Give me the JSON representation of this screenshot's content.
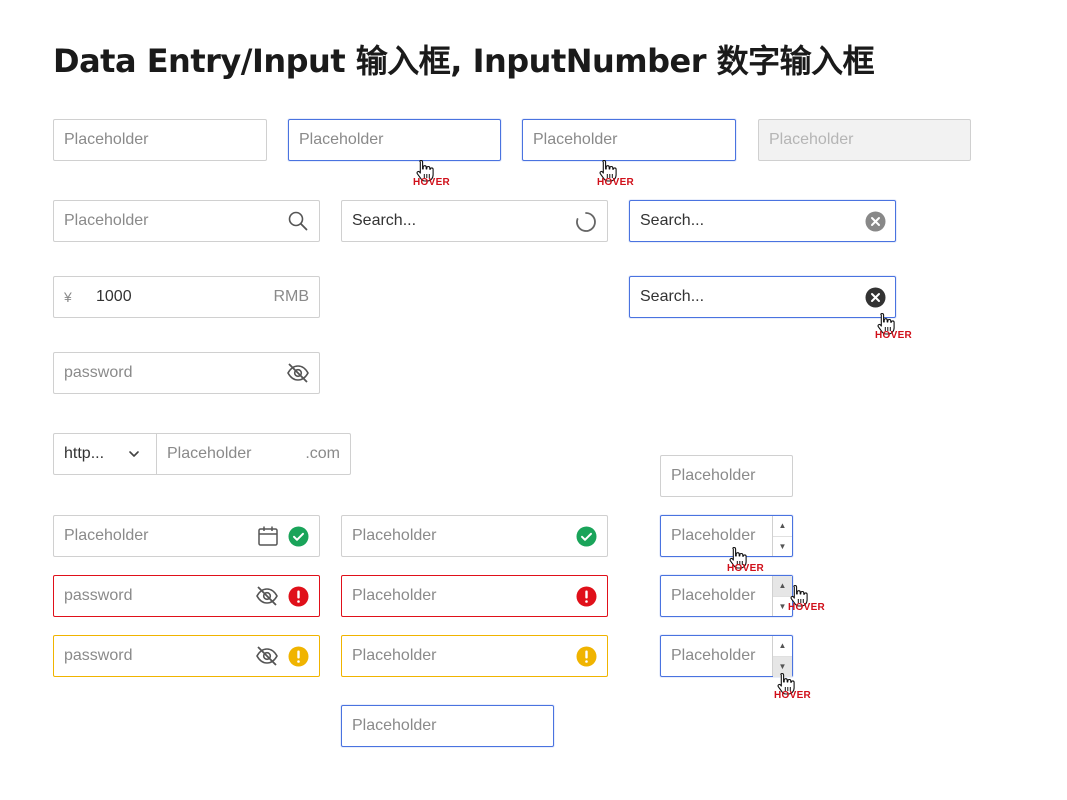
{
  "title": "Data Entry/Input 输入框, InputNumber 数字输入框",
  "hover_label": "HOVER",
  "row1": {
    "default": "Placeholder",
    "hover1": "Placeholder",
    "hover2": "Placeholder",
    "disabled": "Placeholder"
  },
  "search": {
    "with_icon": "Placeholder",
    "loading": "Search...",
    "clearable": "Search...",
    "clear_hover": "Search..."
  },
  "amount": {
    "prefix": "¥",
    "value": "1000",
    "suffix": "RMB"
  },
  "password": {
    "placeholder": "password"
  },
  "addon": {
    "select_value": "http...",
    "placeholder": "Placeholder",
    "suffix": ".com"
  },
  "status": {
    "date_success": "Placeholder",
    "success": "Placeholder",
    "password_error": "password",
    "error": "Placeholder",
    "password_warning": "password",
    "warning": "Placeholder",
    "focused": "Placeholder"
  },
  "input_number": {
    "plain": "Placeholder",
    "hover": "Placeholder",
    "hover_up": "Placeholder",
    "hover_down": "Placeholder",
    "up_arrow": "▲",
    "down_arrow": "▼"
  },
  "colors": {
    "focus": "#4a73e0",
    "success": "#1aa45a",
    "error": "#e0101a",
    "warning": "#f0b400",
    "hover_text": "#d0101a"
  }
}
